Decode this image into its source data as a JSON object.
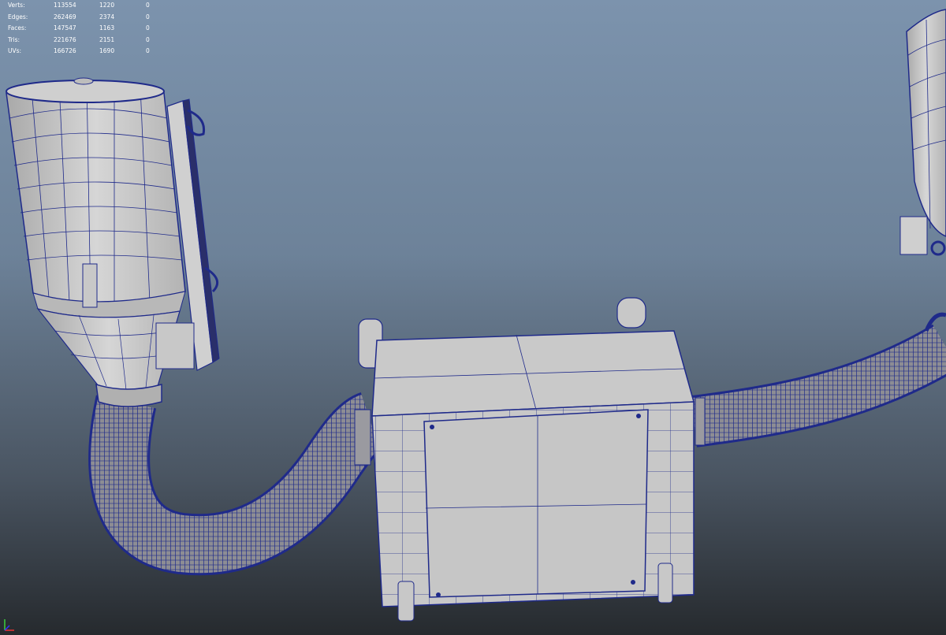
{
  "viewport": {
    "background_top": "#7c93ad",
    "background_bottom": "#262a2e",
    "mesh_color": "#1f2a8a",
    "surface_color": "#c9c9c9"
  },
  "hud": {
    "rows": [
      {
        "label": "Verts:",
        "total": "113554",
        "selected": "1220",
        "components": "0"
      },
      {
        "label": "Edges:",
        "total": "262469",
        "selected": "2374",
        "components": "0"
      },
      {
        "label": "Faces:",
        "total": "147547",
        "selected": "1163",
        "components": "0"
      },
      {
        "label": "Tris:",
        "total": "221676",
        "selected": "2151",
        "components": "0"
      },
      {
        "label": "UVs:",
        "total": "166726",
        "selected": "1690",
        "components": "0"
      }
    ]
  },
  "axis_gizmo": {
    "icon": "xyz-axis-icon"
  }
}
